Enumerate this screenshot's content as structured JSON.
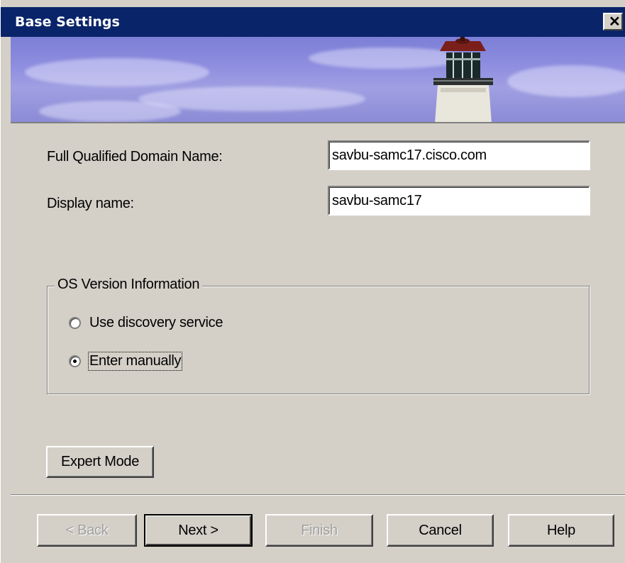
{
  "window": {
    "title": "Base Settings",
    "close_label": "✕"
  },
  "form": {
    "fqdn_label": "Full Qualified Domain Name:",
    "fqdn_value": "savbu-samc17.cisco.com",
    "display_label": "Display name:",
    "display_value": "savbu-samc17"
  },
  "os_group": {
    "legend": "OS Version Information",
    "options": [
      {
        "label": "Use discovery service",
        "selected": false
      },
      {
        "label": "Enter manually",
        "selected": true
      }
    ]
  },
  "buttons": {
    "expert_mode": "Expert Mode",
    "back": "< Back",
    "next": "Next >",
    "finish": "Finish",
    "cancel": "Cancel",
    "help": "Help"
  },
  "colors": {
    "titlebar": "#0a246a",
    "window_bg": "#d4d0c8",
    "banner_sky": "#8f8ee0"
  }
}
